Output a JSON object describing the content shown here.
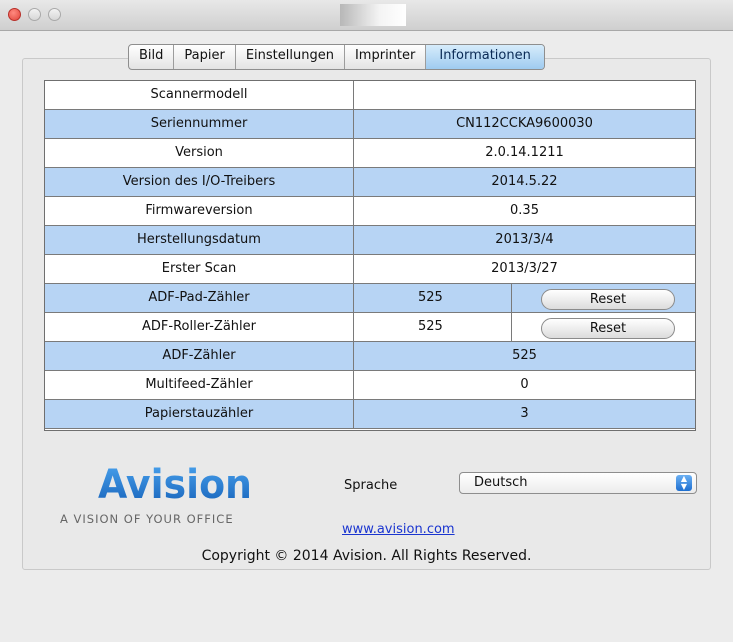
{
  "window": {
    "title": ""
  },
  "tabs": [
    "Bild",
    "Papier",
    "Einstellungen",
    "Imprinter",
    "Informationen"
  ],
  "active_tab": "Informationen",
  "rows": [
    {
      "label": "Scannermodell",
      "value": ""
    },
    {
      "label": "Seriennummer",
      "value": "CN112CCKA9600030"
    },
    {
      "label": "Version",
      "value": "2.0.14.1211"
    },
    {
      "label": "Version des I/O-Treibers",
      "value": "2014.5.22"
    },
    {
      "label": "Firmwareversion",
      "value": "0.35"
    },
    {
      "label": "Herstellungsdatum",
      "value": "2013/3/4"
    },
    {
      "label": "Erster Scan",
      "value": "2013/3/27"
    },
    {
      "label": "ADF-Pad-Zähler",
      "value": "525",
      "button": "Reset"
    },
    {
      "label": "ADF-Roller-Zähler",
      "value": "525",
      "button": "Reset"
    },
    {
      "label": "ADF-Zähler",
      "value": "525"
    },
    {
      "label": "Multifeed-Zähler",
      "value": "0"
    },
    {
      "label": "Papierstauzähler",
      "value": "3"
    }
  ],
  "brand": {
    "logo_text": "Avision",
    "tagline": "A VISION OF YOUR OFFICE",
    "logo_color": "#1f7ad3"
  },
  "language": {
    "label": "Sprache",
    "selected": "Deutsch"
  },
  "website": "www.avision.com",
  "copyright": "Copyright © 2014 Avision. All Rights Reserved.",
  "colors": {
    "row_blue": "#b7d4f4",
    "tab_active": "#9fcbf0",
    "link": "#1a35d0"
  }
}
